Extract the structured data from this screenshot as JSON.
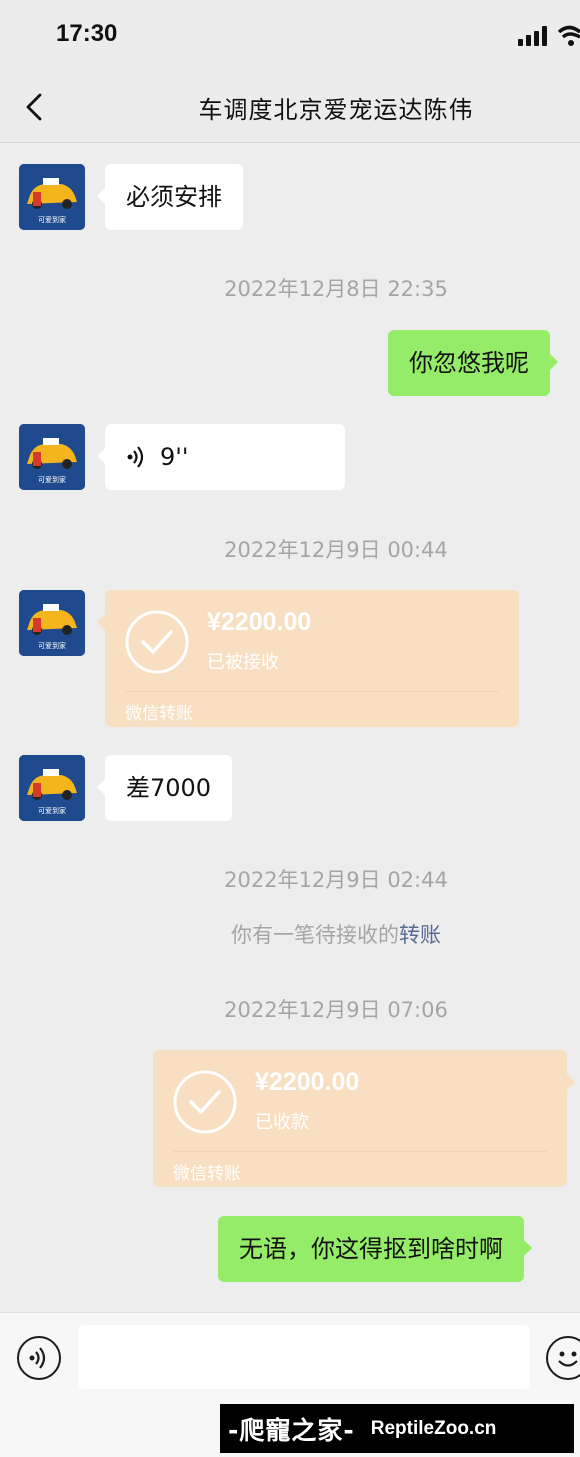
{
  "status_bar": {
    "time": "17:30"
  },
  "header": {
    "title": "车调度北京爱宠运达陈伟"
  },
  "messages": {
    "m1": {
      "text": "必须安排"
    },
    "ts1": {
      "text": "2022年12月8日 22:35"
    },
    "m2": {
      "text": "你忽悠我呢"
    },
    "m3": {
      "duration": "9''"
    },
    "ts2": {
      "text": "2022年12月9日 00:44"
    },
    "t1": {
      "amount": "¥2200.00",
      "status": "已被接收",
      "label": "微信转账"
    },
    "m4": {
      "text": "差7000"
    },
    "ts3": {
      "text": "2022年12月9日 02:44"
    },
    "sys1": {
      "prefix": "你有一笔待接收的",
      "link": "转账"
    },
    "ts4": {
      "text": "2022年12月9日 07:06"
    },
    "t2": {
      "amount": "¥2200.00",
      "status": "已收款",
      "label": "微信转账"
    },
    "m5": {
      "text": "无语，你这得抠到啥时啊"
    }
  },
  "avatar": {
    "caption": "可爱到家"
  },
  "watermark": {
    "cn": "-爬寵之家-",
    "en": "ReptileZoo.cn"
  },
  "colors": {
    "incoming_bubble": "#ffffff",
    "outgoing_bubble": "#95ec69",
    "transfer_card": "#f9dfc2",
    "link": "#576b95"
  }
}
